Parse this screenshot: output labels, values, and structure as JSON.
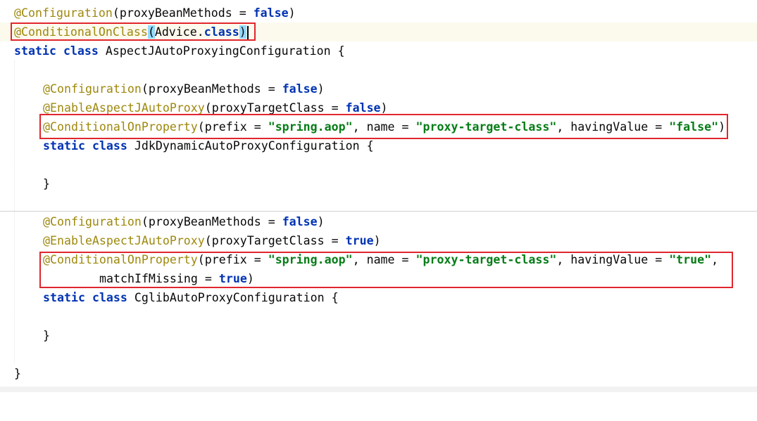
{
  "code": {
    "l1": {
      "ann": "@Configuration",
      "rest_a": "(proxyBeanMethods = ",
      "kw": "false",
      "rest_b": ")"
    },
    "l2": {
      "ann": "@ConditionalOnClass",
      "paren_open": "(",
      "mid": "Advice.",
      "kw": "class",
      "paren_close": ")"
    },
    "l3": {
      "kw1": "static",
      "kw2": "class",
      "rest": " AspectJAutoProxyingConfiguration {"
    },
    "l5": {
      "ann": "@Configuration",
      "rest_a": "(proxyBeanMethods = ",
      "kw": "false",
      "rest_b": ")"
    },
    "l6": {
      "ann": "@EnableAspectJAutoProxy",
      "rest_a": "(proxyTargetClass = ",
      "kw": "false",
      "rest_b": ")"
    },
    "l7": {
      "ann": "@ConditionalOnProperty",
      "a": "(prefix = ",
      "s1": "\"spring.aop\"",
      "b": ", name = ",
      "s2": "\"proxy-target-class\"",
      "c": ", havingValue = ",
      "s3": "\"false\"",
      "d": ")"
    },
    "l8": {
      "kw1": "static",
      "kw2": "class",
      "rest": " JdkDynamicAutoProxyConfiguration {"
    },
    "l10": {
      "text": "}"
    },
    "l12": {
      "ann": "@Configuration",
      "rest_a": "(proxyBeanMethods = ",
      "kw": "false",
      "rest_b": ")"
    },
    "l13": {
      "ann": "@EnableAspectJAutoProxy",
      "rest_a": "(proxyTargetClass = ",
      "kw": "true",
      "rest_b": ")"
    },
    "l14": {
      "ann": "@ConditionalOnProperty",
      "a": "(prefix = ",
      "s1": "\"spring.aop\"",
      "b": ", name = ",
      "s2": "\"proxy-target-class\"",
      "c": ", havingValue = ",
      "s3": "\"true\"",
      "d": ","
    },
    "l15": {
      "a": "matchIfMissing = ",
      "kw": "true",
      "b": ")"
    },
    "l16": {
      "kw1": "static",
      "kw2": "class",
      "rest": " CglibAutoProxyConfiguration {"
    },
    "l18": {
      "text": "}"
    },
    "l20": {
      "text": "}"
    }
  },
  "colors": {
    "annotation": "#9e880d",
    "keyword": "#0033b3",
    "string": "#067d17",
    "highlight_box": "#e0262e",
    "current_line": "#fcfaed",
    "brace_match": "#93d9ff"
  }
}
